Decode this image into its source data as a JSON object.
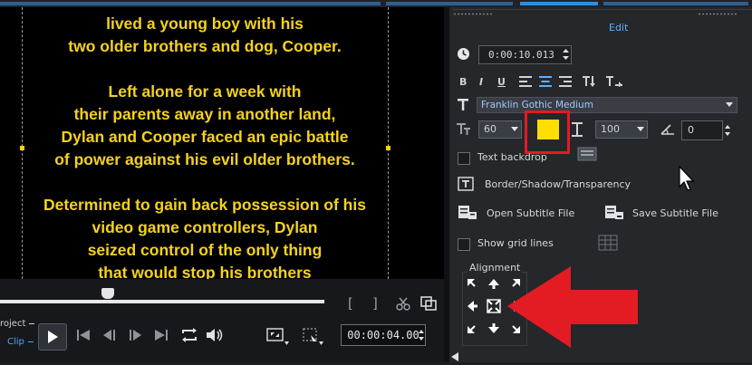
{
  "preview": {
    "subtitle_lines": [
      "lived a young boy with his",
      "two older brothers and dog, Cooper.",
      "",
      "Left alone for a week with",
      "their parents away in another land,",
      "Dylan and Cooper faced an epic battle",
      "of power against his evil older brothers.",
      "",
      "Determined to gain back possession of his",
      "video game controllers, Dylan",
      "seized control of the only thing",
      "that would stop his brothers"
    ],
    "subtitle_color": "#f5d21c"
  },
  "transport": {
    "project_label": "roject",
    "clip_label": "Clip",
    "timecode": "00:00:04.00",
    "mark_in": "[",
    "mark_out": "]"
  },
  "panel": {
    "tab_label": "Edit",
    "duration": "0:00:10.013",
    "format_buttons": [
      "B",
      "I",
      "U"
    ],
    "font_name": "Franklin Gothic Medium",
    "font_size": "60",
    "line_spacing": "100",
    "rotation": "0",
    "text_color": "#ffde00",
    "text_backdrop_label": "Text backdrop",
    "border_shadow_label": "Border/Shadow/Transparency",
    "open_subtitle_label": "Open Subtitle File",
    "save_subtitle_label": "Save Subtitle File",
    "show_grid_label": "Show grid lines",
    "alignment_label": "Alignment"
  },
  "colors": {
    "accent": "#4aa3ff",
    "highlight": "#e31b23"
  }
}
